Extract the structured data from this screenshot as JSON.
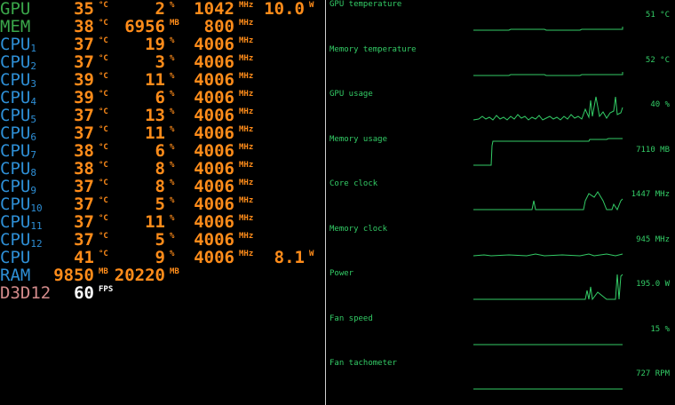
{
  "colors": {
    "gpu_label": "#3aa64a",
    "mem_label": "#3aa64a",
    "cpu_label": "#2e8fd6",
    "ram_label": "#2e8fd6",
    "d3d_label": "#d38b8b",
    "value": "#ff8c1a",
    "fps_value": "#ffffff",
    "graph": "#33cc66"
  },
  "osd": {
    "gpu": {
      "label": "GPU",
      "temp": "35",
      "temp_unit": "°C",
      "usage": "2",
      "usage_unit": "%",
      "clock": "1042",
      "clock_unit": "MHz",
      "power": "10.0",
      "power_unit": "W"
    },
    "mem": {
      "label": "MEM",
      "temp": "38",
      "temp_unit": "°C",
      "used": "6956",
      "used_unit": "MB",
      "clock": "800",
      "clock_unit": "MHz"
    },
    "cpus": [
      {
        "label": "CPU",
        "sub": "1",
        "temp": "37",
        "usage": "19",
        "clock": "4006"
      },
      {
        "label": "CPU",
        "sub": "2",
        "temp": "37",
        "usage": "3",
        "clock": "4006"
      },
      {
        "label": "CPU",
        "sub": "3",
        "temp": "39",
        "usage": "11",
        "clock": "4006"
      },
      {
        "label": "CPU",
        "sub": "4",
        "temp": "39",
        "usage": "6",
        "clock": "4006"
      },
      {
        "label": "CPU",
        "sub": "5",
        "temp": "37",
        "usage": "13",
        "clock": "4006"
      },
      {
        "label": "CPU",
        "sub": "6",
        "temp": "37",
        "usage": "11",
        "clock": "4006"
      },
      {
        "label": "CPU",
        "sub": "7",
        "temp": "38",
        "usage": "6",
        "clock": "4006"
      },
      {
        "label": "CPU",
        "sub": "8",
        "temp": "38",
        "usage": "8",
        "clock": "4006"
      },
      {
        "label": "CPU",
        "sub": "9",
        "temp": "37",
        "usage": "8",
        "clock": "4006"
      },
      {
        "label": "CPU",
        "sub": "10",
        "temp": "37",
        "usage": "5",
        "clock": "4006"
      },
      {
        "label": "CPU",
        "sub": "11",
        "temp": "37",
        "usage": "11",
        "clock": "4006"
      },
      {
        "label": "CPU",
        "sub": "12",
        "temp": "37",
        "usage": "5",
        "clock": "4006"
      }
    ],
    "cpu_units": {
      "temp": "°C",
      "usage": "%",
      "clock": "MHz"
    },
    "cpu_total": {
      "label": "CPU",
      "temp": "41",
      "temp_unit": "°C",
      "usage": "9",
      "usage_unit": "%",
      "clock": "4006",
      "clock_unit": "MHz",
      "power": "8.1",
      "power_unit": "W"
    },
    "ram": {
      "label": "RAM",
      "used": "9850",
      "used_unit": "MB",
      "total": "20220",
      "total_unit": "MB"
    },
    "d3d": {
      "label": "D3D12",
      "fps": "60",
      "fps_unit": "FPS"
    }
  },
  "graphs": [
    {
      "title": "GPU temperature",
      "value": "51 °C",
      "trace": "flat_low"
    },
    {
      "title": "Memory temperature",
      "value": "52 °C",
      "trace": "flat_low"
    },
    {
      "title": "GPU usage",
      "value": "40 %",
      "trace": "noisy_spike"
    },
    {
      "title": "Memory usage",
      "value": "7110 MB",
      "trace": "step_high"
    },
    {
      "title": "Core clock",
      "value": "1447 MHz",
      "trace": "bumps"
    },
    {
      "title": "Memory clock",
      "value": "945 MHz",
      "trace": "low_dashes"
    },
    {
      "title": "Power",
      "value": "195.0 W",
      "trace": "power_spike"
    },
    {
      "title": "Fan speed",
      "value": "15 %",
      "trace": "flat_mid"
    },
    {
      "title": "Fan tachometer",
      "value": "727 RPM",
      "trace": "flat_mid"
    }
  ]
}
